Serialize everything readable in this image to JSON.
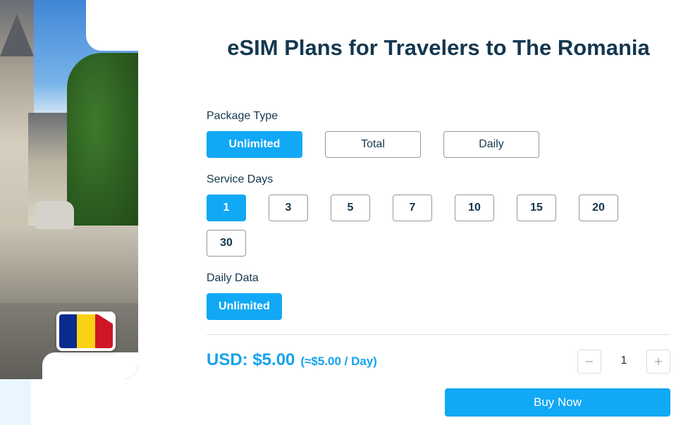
{
  "title": "eSIM Plans for Travelers to The Romania",
  "package_type": {
    "label": "Package Type",
    "options": [
      "Unlimited",
      "Total",
      "Daily"
    ],
    "selected": "Unlimited"
  },
  "service_days": {
    "label": "Service Days",
    "options": [
      "1",
      "3",
      "5",
      "7",
      "10",
      "15",
      "20",
      "30"
    ],
    "selected": "1"
  },
  "daily_data": {
    "label": "Daily Data",
    "options": [
      "Unlimited"
    ],
    "selected": "Unlimited"
  },
  "price": {
    "main": "USD: $5.00",
    "per_day": "(≈$5.00 / Day)"
  },
  "quantity": {
    "value": "1",
    "minus_icon": "minus-icon",
    "plus_icon": "plus-icon"
  },
  "buy_label": "Buy Now",
  "flag": {
    "country_icon": "romania-flag-icon",
    "colors": [
      "#0b2b8f",
      "#fbd116",
      "#cf1526"
    ]
  },
  "colors": {
    "accent": "#11a8f5",
    "heading": "#14374f"
  }
}
